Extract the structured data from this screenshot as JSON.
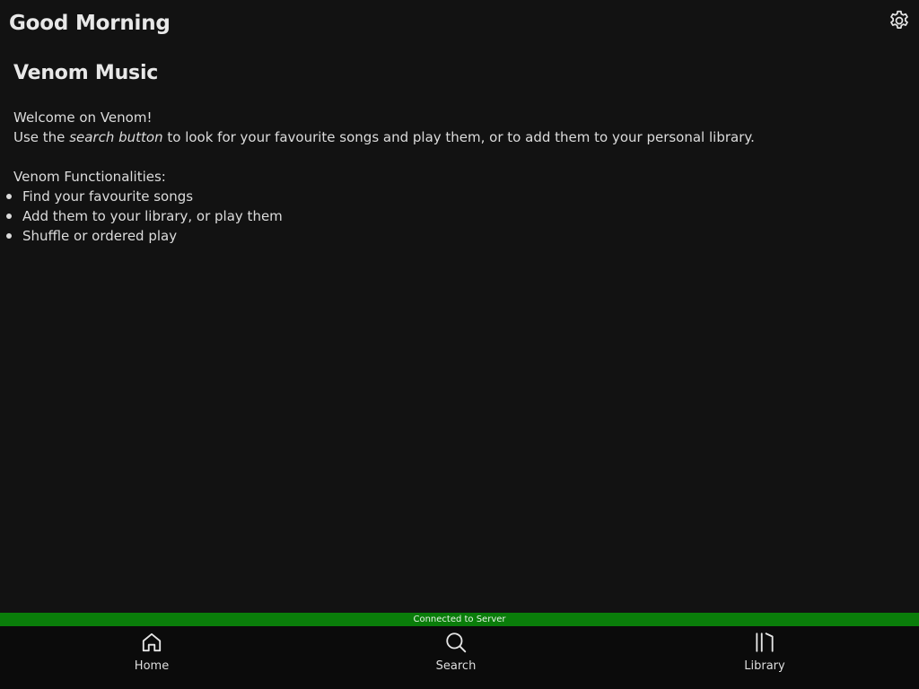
{
  "header": {
    "greeting": "Good Morning",
    "settings_icon": "gear-icon"
  },
  "main": {
    "title": "Venom Music",
    "welcome": "Welcome on Venom!",
    "instructions": {
      "before": "Use the ",
      "emphasis": "search button",
      "after": " to look for your favourite songs and play them, or to add them to your personal library."
    },
    "features_heading": "Venom Functionalities:",
    "features": [
      "Find your favourite songs",
      "Add them to your library, or play them",
      "Shuffle or ordered play"
    ]
  },
  "status": {
    "text": "Connected to Server",
    "color": "#0a7d0a"
  },
  "nav": {
    "items": [
      {
        "label": "Home",
        "icon": "home-icon"
      },
      {
        "label": "Search",
        "icon": "search-icon"
      },
      {
        "label": "Library",
        "icon": "library-icon"
      }
    ]
  },
  "colors": {
    "background": "#121212",
    "nav_background": "#0b0b0b",
    "text": "#e6e6e6"
  }
}
